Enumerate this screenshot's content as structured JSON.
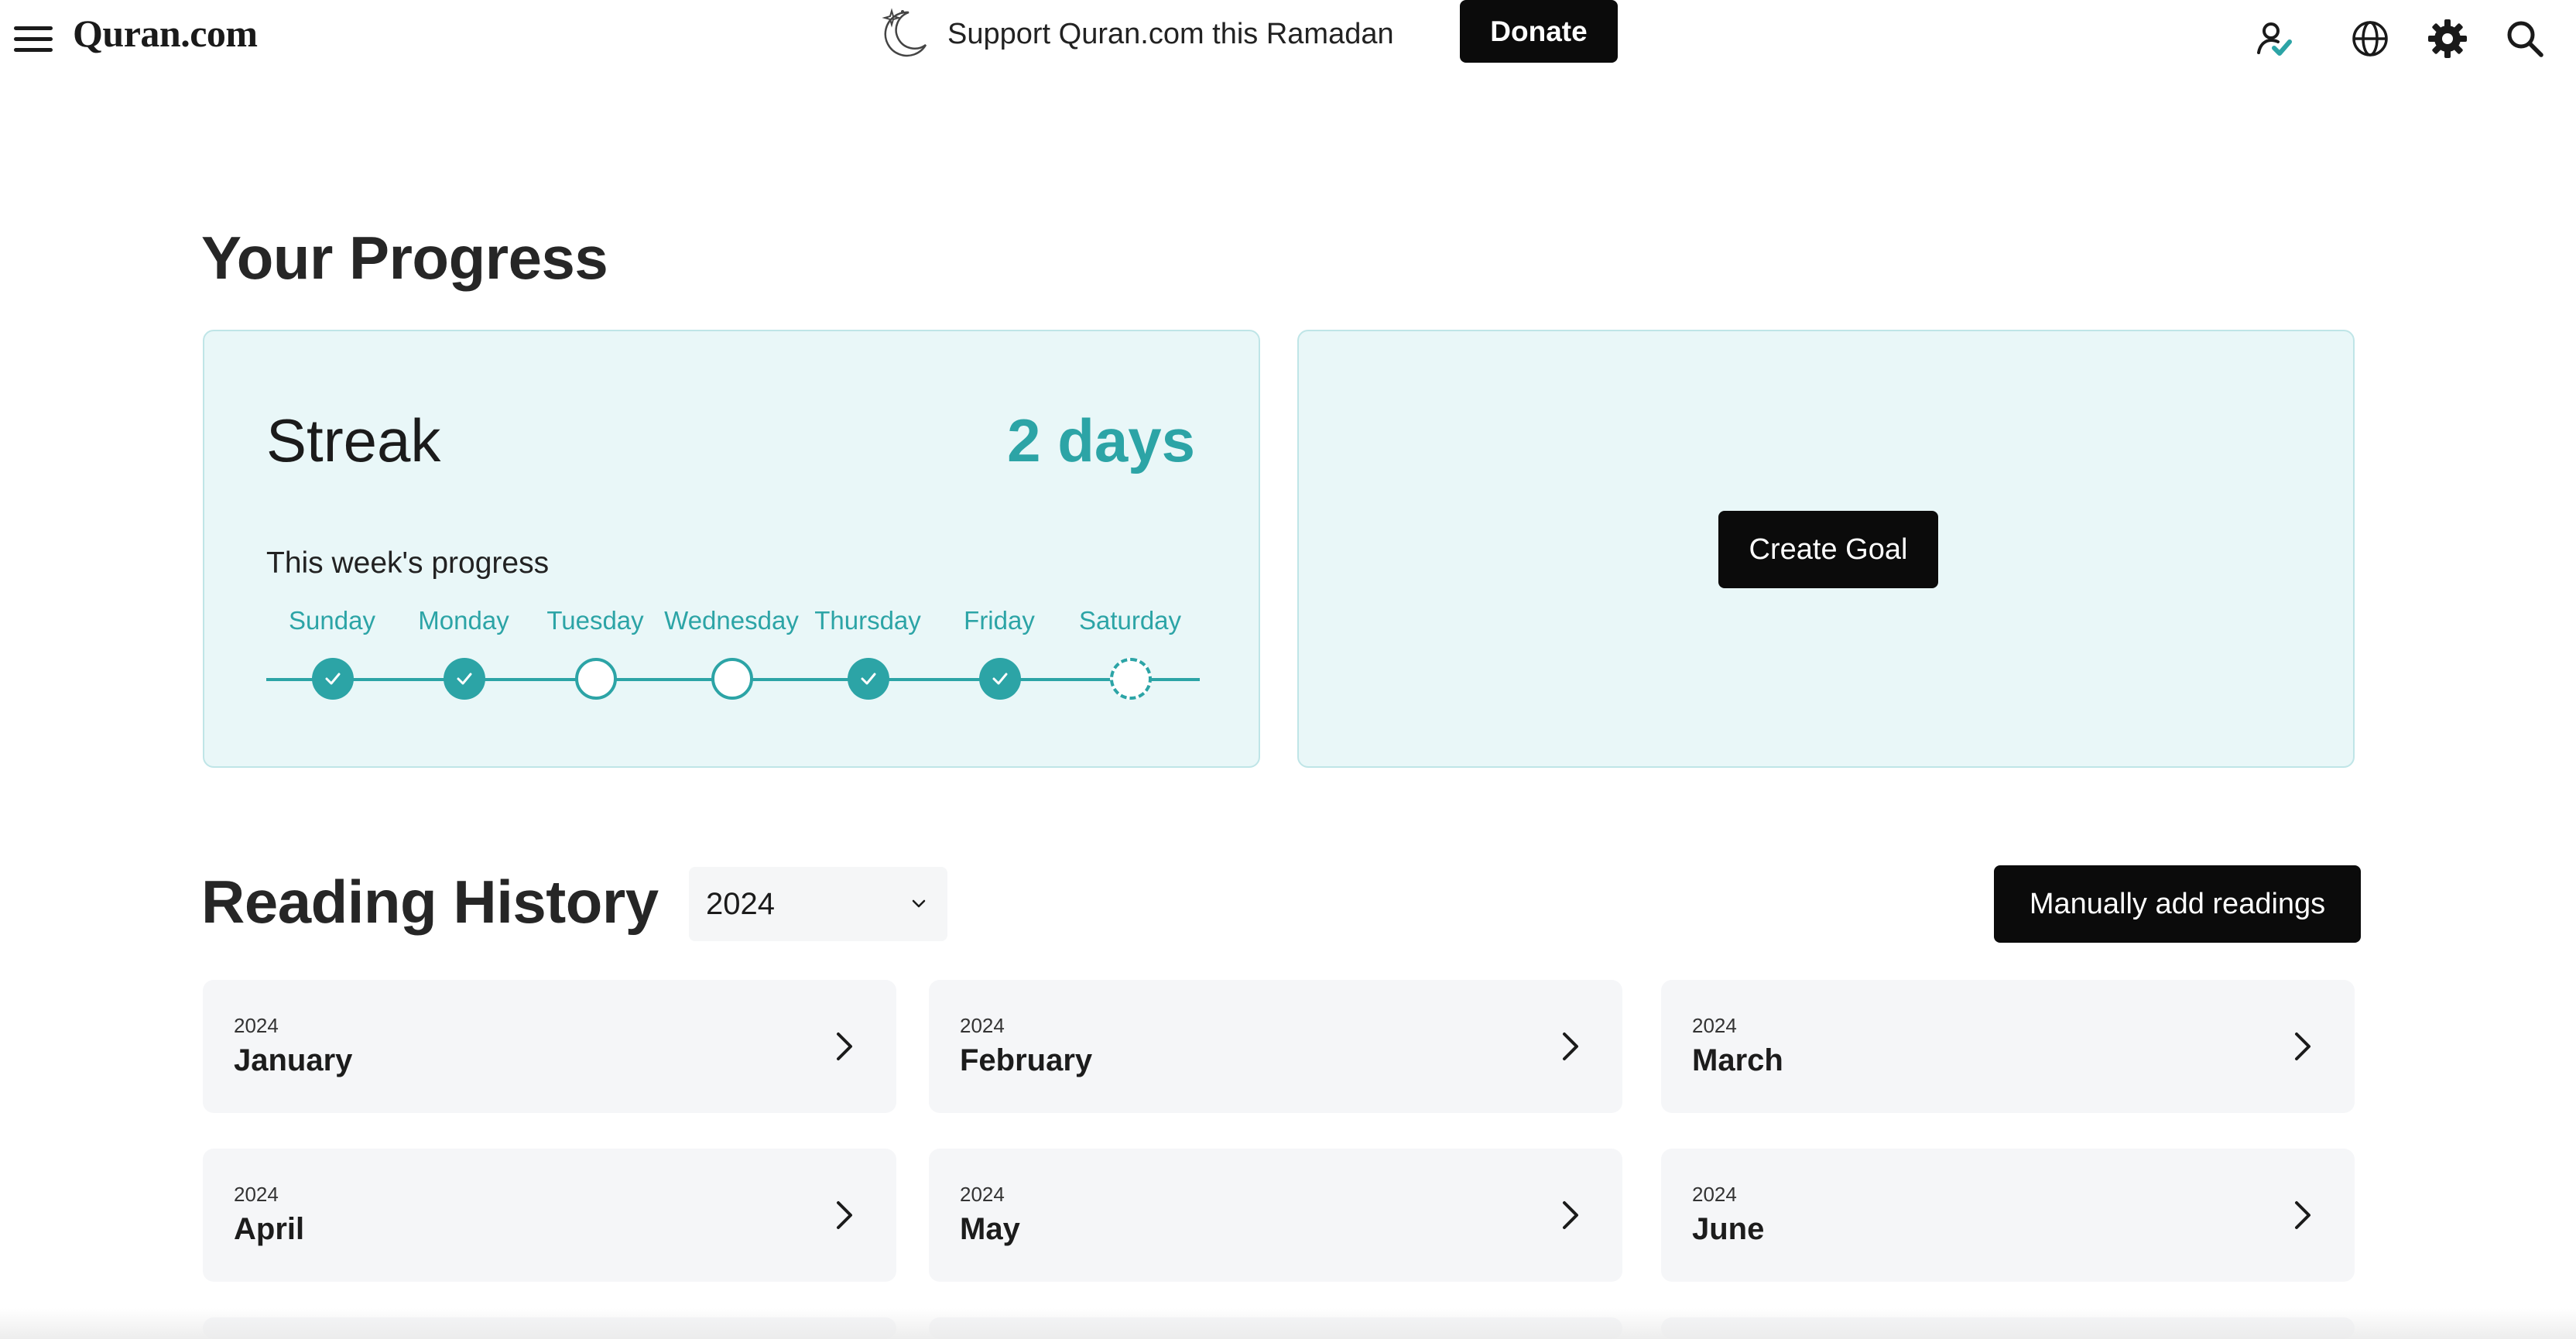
{
  "nav": {
    "logo": "Quran.com",
    "support_text": "Support Quran.com this Ramadan",
    "donate_label": "Donate",
    "icons": [
      "user-check-icon",
      "globe-icon",
      "gear-icon",
      "search-icon"
    ],
    "accent": "#2ca4a6"
  },
  "progress": {
    "title": "Your Progress",
    "streak": {
      "label": "Streak",
      "value": "2 days",
      "week_label": "This week's progress",
      "days": [
        {
          "name": "Sunday",
          "status": "done"
        },
        {
          "name": "Monday",
          "status": "done"
        },
        {
          "name": "Tuesday",
          "status": "missed"
        },
        {
          "name": "Wednesday",
          "status": "missed"
        },
        {
          "name": "Thursday",
          "status": "done"
        },
        {
          "name": "Friday",
          "status": "done"
        },
        {
          "name": "Saturday",
          "status": "pending"
        }
      ]
    },
    "goal": {
      "button_label": "Create Goal"
    }
  },
  "history": {
    "title": "Reading History",
    "year": "2024",
    "manual_button_label": "Manually add readings",
    "months": [
      {
        "year": "2024",
        "name": "January"
      },
      {
        "year": "2024",
        "name": "February"
      },
      {
        "year": "2024",
        "name": "March"
      },
      {
        "year": "2024",
        "name": "April"
      },
      {
        "year": "2024",
        "name": "May"
      },
      {
        "year": "2024",
        "name": "June"
      }
    ]
  },
  "colors": {
    "accent": "#2ca4a6",
    "card_bg": "#e9f7f8",
    "button_bg": "#0b0b0b"
  }
}
